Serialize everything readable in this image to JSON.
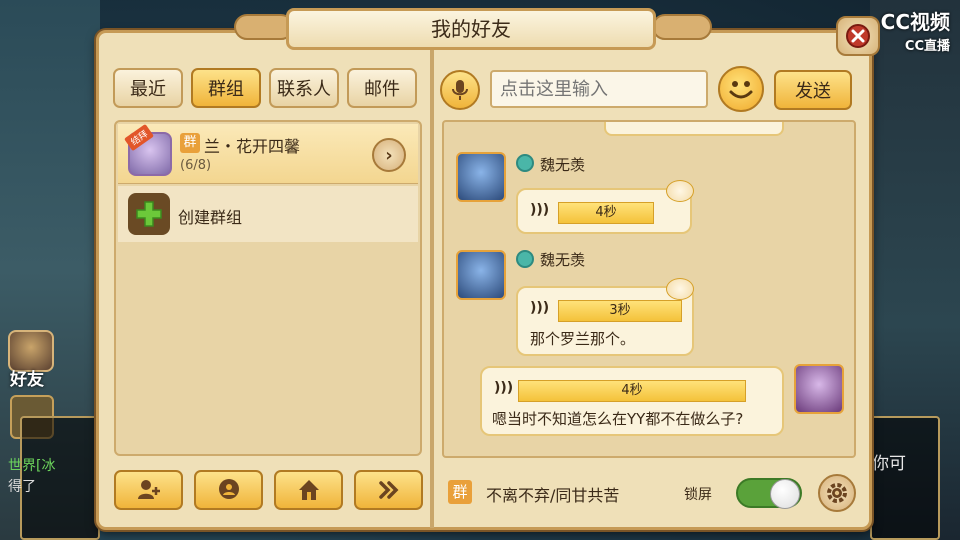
{
  "window": {
    "title": "我的好友"
  },
  "watermark": {
    "brand": "CC视频",
    "sub": "CC直播"
  },
  "tabs": [
    {
      "label": "最近",
      "active": false
    },
    {
      "label": "群组",
      "active": true
    },
    {
      "label": "联系人",
      "active": false
    },
    {
      "label": "邮件",
      "active": false
    }
  ],
  "groups": [
    {
      "badge": "群",
      "name": "兰・花开四馨",
      "count": "(6/8)",
      "ribbon": "结拜"
    }
  ],
  "create_group": {
    "label": "创建群组"
  },
  "input": {
    "placeholder": "点击这里输入"
  },
  "send": {
    "label": "发送"
  },
  "messages": [
    {
      "sender": "魏无羡",
      "side": "left",
      "duration": "4秒",
      "text": ""
    },
    {
      "sender": "魏无羡",
      "side": "left",
      "duration": "3秒",
      "text": "那个罗兰那个。"
    },
    {
      "sender": "",
      "side": "right",
      "duration": "4秒",
      "text": "嗯当时不知道怎么在YY都不在做么子?"
    }
  ],
  "footer": {
    "group_badge": "群",
    "motto": "不离不弃/同甘共苦",
    "lock_label": "锁屏",
    "lock_enabled": true
  },
  "background": {
    "side_label": "好友",
    "chat_left_1": "世界[冰",
    "chat_left_2": "得了",
    "chat_right": "你可"
  },
  "colors": {
    "accent": "#f0b43a",
    "panel": "#efe0b8",
    "border": "#c69a55"
  }
}
